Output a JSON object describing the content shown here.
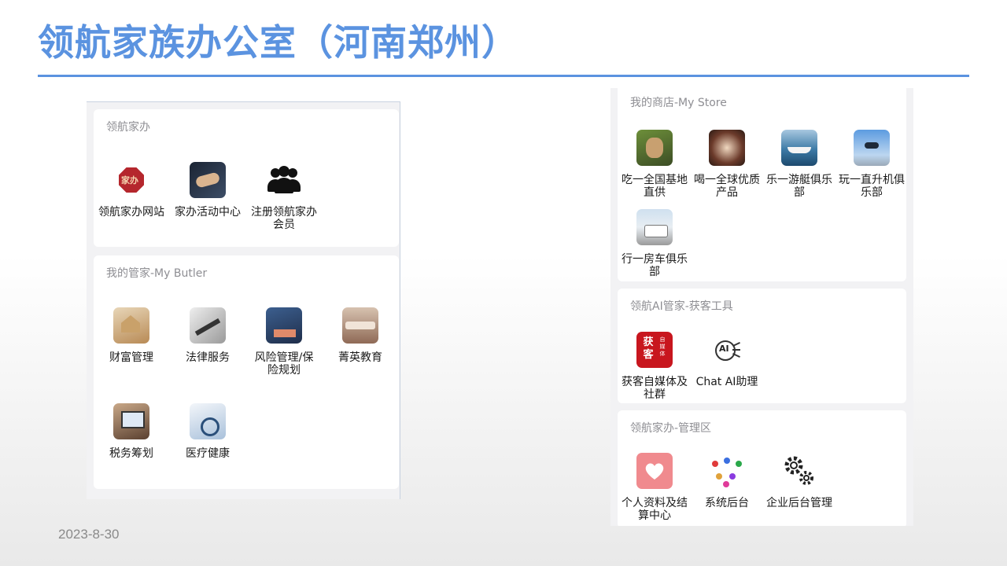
{
  "slide": {
    "title": "领航家族办公室（河南郑州）",
    "date": "2023-8-30"
  },
  "left_panel": {
    "family_office": {
      "title": "领航家办",
      "items": [
        {
          "label": "领航家办网站",
          "icon": "seal-logo-icon"
        },
        {
          "label": "家办活动中心",
          "icon": "handshake-icon"
        },
        {
          "label": "注册领航家办会员",
          "icon": "people-group-icon"
        }
      ]
    },
    "butler": {
      "title": "我的管家-My Butler",
      "items": [
        {
          "label": "财富管理",
          "icon": "wealth-house-icon"
        },
        {
          "label": "法律服务",
          "icon": "law-gavel-icon"
        },
        {
          "label": "风险管理/保险规划",
          "icon": "risk-chart-icon"
        },
        {
          "label": "菁英教育",
          "icon": "education-class-icon"
        },
        {
          "label": "税务筹划",
          "icon": "tax-laptop-icon"
        },
        {
          "label": "医疗健康",
          "icon": "medical-stethoscope-icon"
        }
      ]
    }
  },
  "right_panel": {
    "store": {
      "title": "我的商店-My Store",
      "items": [
        {
          "label": "吃一全国基地直供",
          "icon": "food-icon"
        },
        {
          "label": "喝一全球优质产品",
          "icon": "drink-toast-icon"
        },
        {
          "label": "乐一游艇俱乐部",
          "icon": "yacht-icon"
        },
        {
          "label": "玩一直升机俱乐部",
          "icon": "helicopter-icon"
        },
        {
          "label": "行一房车俱乐部",
          "icon": "rv-camper-icon"
        }
      ]
    },
    "ai": {
      "title": "领航AI管家-获客工具",
      "items": [
        {
          "label": "获客自媒体及社群",
          "icon": "huoke-logo-icon",
          "icon_text": "获客",
          "icon_subtext": "自媒体"
        },
        {
          "label": "Chat AI助理",
          "icon": "ai-brain-icon",
          "icon_text": "AI"
        }
      ]
    },
    "admin": {
      "title": "领航家办-管理区",
      "items": [
        {
          "label": "个人资料及结算中心",
          "icon": "heart-icon"
        },
        {
          "label": "系统后台",
          "icon": "network-people-icon"
        },
        {
          "label": "企业后台管理",
          "icon": "gears-icon"
        }
      ]
    }
  },
  "colors": {
    "title_blue": "#5b93e0",
    "card_bg": "#ffffff",
    "panel_bg": "#f2f2f4",
    "section_title_gray": "#8e8e93"
  }
}
